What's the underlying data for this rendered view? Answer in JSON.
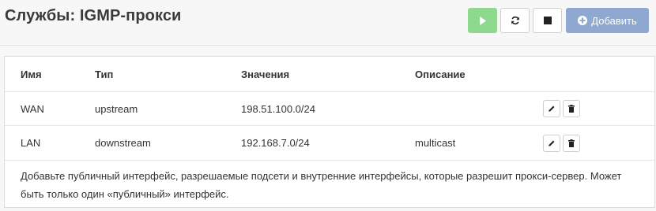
{
  "page": {
    "title": "Службы: IGMP-прокси"
  },
  "toolbar": {
    "play": "play-icon",
    "refresh": "refresh-icon",
    "stop": "stop-icon",
    "add_label": "Добавить"
  },
  "table": {
    "headers": {
      "name": "Имя",
      "type": "Тип",
      "values": "Значения",
      "description": "Описание"
    },
    "rows": [
      {
        "name": "WAN",
        "type": "upstream",
        "values": "198.51.100.0/24",
        "description": ""
      },
      {
        "name": "LAN",
        "type": "downstream",
        "values": "192.168.7.0/24",
        "description": "multicast"
      }
    ]
  },
  "note": "Добавьте публичный интерфейс, разрешаемые подсети и внутренние интерфейсы, которые разрешит прокси-сервер. Может быть только один «публичный» интерфейс.",
  "colors": {
    "play": "#8fd98f",
    "add": "#8fa8cf"
  }
}
